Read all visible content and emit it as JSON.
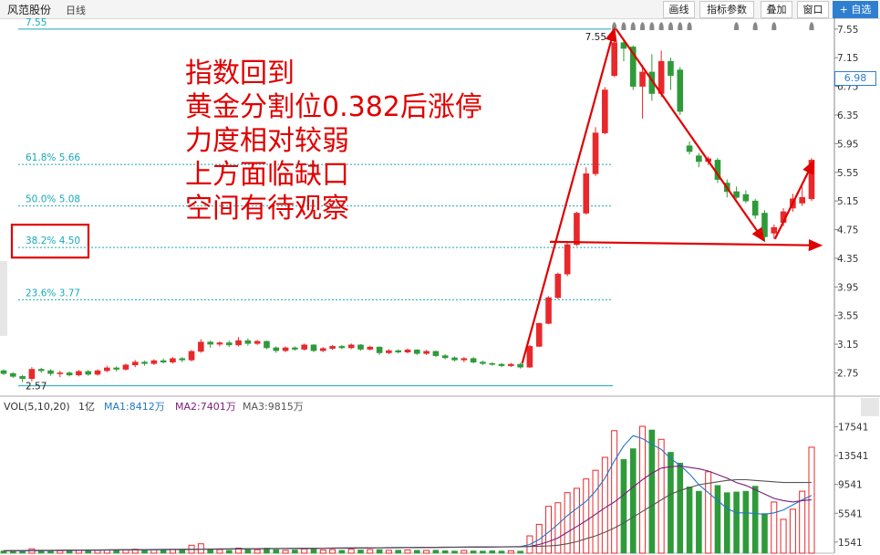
{
  "header": {
    "stock_name": "风范股份",
    "period": "日线",
    "buttons": [
      {
        "label": "画线"
      },
      {
        "label": "指标参数"
      },
      {
        "label": "叠加"
      },
      {
        "label": "窗口"
      },
      {
        "label": "+ 自选"
      }
    ]
  },
  "annotation_lines": [
    "指数回到",
    "黄金分割位0.382后涨停",
    "力度相对较弱",
    "上方面临缺口",
    "空间有待观察"
  ],
  "current_price_tag": "6.98",
  "volume_legend": {
    "indicator": "VOL(5,10,20)",
    "unit": "1亿",
    "ma1": "MA1:8412万",
    "ma2": "MA2:7401万",
    "ma3": "MA3:9815万"
  },
  "colors": {
    "up": "#e8282b",
    "down": "#2f9a3a",
    "fib": "#17a9b7",
    "ma1": "#1f77c8",
    "ma2": "#7a1c7a",
    "ma3": "#555555",
    "annot": "#e00000"
  },
  "chart_data": [
    {
      "type": "candlestick",
      "ylim": [
        2.45,
        7.65
      ],
      "y_ticks": [
        "7.55",
        "7.15",
        "6.75",
        "6.35",
        "5.95",
        "5.55",
        "5.15",
        "4.75",
        "4.35",
        "3.95",
        "3.55",
        "3.15",
        "2.75"
      ],
      "fib_levels": [
        {
          "label": "7.55",
          "value": 7.55
        },
        {
          "label": "61.8% 5.66",
          "value": 5.66
        },
        {
          "label": "50.0% 5.08",
          "value": 5.08
        },
        {
          "label": "38.2% 4.50",
          "value": 4.5
        },
        {
          "label": "23.6% 3.77",
          "value": 3.77
        },
        {
          "label": "2.57",
          "value": 2.57
        }
      ],
      "high_label": "7.55",
      "low_label": "2.57",
      "candles": [
        [
          2.78,
          2.74,
          2.8,
          2.72
        ],
        [
          2.74,
          2.7,
          2.76,
          2.68
        ],
        [
          2.7,
          2.67,
          2.72,
          2.62
        ],
        [
          2.67,
          2.8,
          2.83,
          2.63
        ],
        [
          2.8,
          2.78,
          2.82,
          2.75
        ],
        [
          2.78,
          2.74,
          2.8,
          2.71
        ],
        [
          2.74,
          2.75,
          2.78,
          2.69
        ],
        [
          2.75,
          2.72,
          2.77,
          2.7
        ],
        [
          2.72,
          2.77,
          2.79,
          2.7
        ],
        [
          2.77,
          2.73,
          2.79,
          2.71
        ],
        [
          2.73,
          2.78,
          2.8,
          2.71
        ],
        [
          2.78,
          2.82,
          2.85,
          2.76
        ],
        [
          2.82,
          2.8,
          2.84,
          2.77
        ],
        [
          2.8,
          2.86,
          2.88,
          2.78
        ],
        [
          2.86,
          2.9,
          2.93,
          2.83
        ],
        [
          2.9,
          2.88,
          2.92,
          2.85
        ],
        [
          2.88,
          2.92,
          2.94,
          2.86
        ],
        [
          2.92,
          2.9,
          2.95,
          2.88
        ],
        [
          2.9,
          2.95,
          2.97,
          2.88
        ],
        [
          2.95,
          2.93,
          2.97,
          2.9
        ],
        [
          2.93,
          3.05,
          3.07,
          2.91
        ],
        [
          3.05,
          3.18,
          3.22,
          3.03
        ],
        [
          3.18,
          3.15,
          3.2,
          3.1
        ],
        [
          3.15,
          3.17,
          3.19,
          3.12
        ],
        [
          3.17,
          3.14,
          3.2,
          3.11
        ],
        [
          3.14,
          3.2,
          3.25,
          3.12
        ],
        [
          3.2,
          3.16,
          3.23,
          3.13
        ],
        [
          3.16,
          3.19,
          3.21,
          3.14
        ],
        [
          3.19,
          3.1,
          3.2,
          3.08
        ],
        [
          3.1,
          3.06,
          3.12,
          3.03
        ],
        [
          3.06,
          3.1,
          3.12,
          3.04
        ],
        [
          3.1,
          3.08,
          3.12,
          3.06
        ],
        [
          3.08,
          3.14,
          3.16,
          3.06
        ],
        [
          3.14,
          3.06,
          3.15,
          3.04
        ],
        [
          3.06,
          3.09,
          3.11,
          3.04
        ],
        [
          3.09,
          3.12,
          3.14,
          3.07
        ],
        [
          3.12,
          3.1,
          3.14,
          3.08
        ],
        [
          3.1,
          3.14,
          3.16,
          3.08
        ],
        [
          3.14,
          3.08,
          3.15,
          3.06
        ],
        [
          3.08,
          3.11,
          3.13,
          3.06
        ],
        [
          3.11,
          3.03,
          3.12,
          3.0
        ],
        [
          3.03,
          3.06,
          3.08,
          3.01
        ],
        [
          3.06,
          3.04,
          3.08,
          3.02
        ],
        [
          3.04,
          3.07,
          3.09,
          3.02
        ],
        [
          3.07,
          3.02,
          3.08,
          3.0
        ],
        [
          3.02,
          3.05,
          3.07,
          3.0
        ],
        [
          3.05,
          2.99,
          3.06,
          2.97
        ],
        [
          2.99,
          2.96,
          3.01,
          2.94
        ],
        [
          2.96,
          2.93,
          2.98,
          2.91
        ],
        [
          2.93,
          2.95,
          2.97,
          2.9
        ],
        [
          2.95,
          2.9,
          2.97,
          2.88
        ],
        [
          2.9,
          2.88,
          2.92,
          2.86
        ],
        [
          2.88,
          2.87,
          2.9,
          2.85
        ],
        [
          2.87,
          2.85,
          2.89,
          2.83
        ],
        [
          2.85,
          2.87,
          2.89,
          2.83
        ],
        [
          2.87,
          2.83,
          2.89,
          2.81
        ],
        [
          2.83,
          3.12,
          3.14,
          2.82
        ],
        [
          3.12,
          3.44,
          3.45,
          3.11
        ],
        [
          3.44,
          3.8,
          3.82,
          3.43
        ],
        [
          3.8,
          4.13,
          4.15,
          3.78
        ],
        [
          4.13,
          4.54,
          4.58,
          4.1
        ],
        [
          4.54,
          4.98,
          5.0,
          4.52
        ],
        [
          4.98,
          5.53,
          5.62,
          4.96
        ],
        [
          5.53,
          6.1,
          6.18,
          5.5
        ],
        [
          6.1,
          6.7,
          6.74,
          6.08
        ],
        [
          6.9,
          7.36,
          7.55,
          6.88
        ],
        [
          7.36,
          7.28,
          7.4,
          7.1
        ],
        [
          7.3,
          6.75,
          7.32,
          6.7
        ],
        [
          6.75,
          6.95,
          7.05,
          6.3
        ],
        [
          6.95,
          6.65,
          7.2,
          6.55
        ],
        [
          6.65,
          7.1,
          7.25,
          6.6
        ],
        [
          7.1,
          6.9,
          7.15,
          6.7
        ],
        [
          6.98,
          6.4,
          7.02,
          6.35
        ],
        [
          5.92,
          5.84,
          5.98,
          5.8
        ],
        [
          5.78,
          5.7,
          5.82,
          5.62
        ],
        [
          5.7,
          5.74,
          5.77,
          5.65
        ],
        [
          5.72,
          5.45,
          5.75,
          5.4
        ],
        [
          5.4,
          5.28,
          5.45,
          5.2
        ],
        [
          5.28,
          5.2,
          5.35,
          5.18
        ],
        [
          5.24,
          5.15,
          5.3,
          5.12
        ],
        [
          5.15,
          4.95,
          5.18,
          4.9
        ],
        [
          4.98,
          4.65,
          5.02,
          4.58
        ],
        [
          4.7,
          4.78,
          4.82,
          4.62
        ],
        [
          4.85,
          5.0,
          5.05,
          4.8
        ],
        [
          5.05,
          5.18,
          5.25,
          5.0
        ],
        [
          5.12,
          5.2,
          5.35,
          5.08
        ],
        [
          5.18,
          5.72,
          5.75,
          5.15
        ]
      ]
    },
    {
      "type": "bar",
      "ylim": [
        0,
        19000
      ],
      "y_ticks": [
        "17541",
        "13541",
        "9541",
        "5541",
        "1541"
      ],
      "series": [
        {
          "name": "MA1:8412万",
          "values": [
            300,
            320,
            330,
            340,
            350,
            360,
            370,
            380,
            390,
            400,
            410,
            420,
            430,
            440,
            450,
            460,
            470,
            480,
            490,
            500,
            520,
            540,
            560,
            580,
            600,
            610,
            620,
            630,
            640,
            650,
            660,
            670,
            680,
            690,
            700,
            710,
            720,
            730,
            740,
            750,
            760,
            770,
            780,
            790,
            800,
            810,
            820,
            830,
            840,
            850,
            860,
            870,
            880,
            890,
            900,
            910,
            1200,
            1900,
            2900,
            4000,
            5200,
            6200,
            7200,
            8600,
            10400,
            12800,
            14900,
            16300,
            15900,
            15100,
            14400,
            13100,
            12200,
            11000,
            9500,
            8400,
            7300,
            6200,
            5600,
            5600,
            5500,
            5400,
            5600,
            6000,
            6700,
            7400,
            8000
          ]
        },
        {
          "name": "MA2:7401万",
          "values": [
            330,
            340,
            350,
            360,
            370,
            380,
            390,
            400,
            410,
            420,
            430,
            440,
            450,
            460,
            470,
            480,
            490,
            500,
            510,
            520,
            530,
            540,
            550,
            560,
            570,
            580,
            590,
            600,
            610,
            620,
            630,
            640,
            650,
            660,
            670,
            680,
            690,
            700,
            710,
            720,
            730,
            740,
            750,
            760,
            770,
            780,
            790,
            800,
            810,
            820,
            830,
            840,
            850,
            860,
            870,
            880,
            950,
            1200,
            1600,
            2100,
            2900,
            3700,
            4500,
            5400,
            6300,
            7100,
            8100,
            9200,
            10200,
            11100,
            11800,
            12000,
            12100,
            11900,
            11700,
            11400,
            10900,
            10400,
            9800,
            9400,
            8800,
            8200,
            7600,
            7300,
            7100,
            7300,
            7400
          ]
        },
        {
          "name": "MA3:9815万",
          "values": [
            360,
            370,
            380,
            390,
            400,
            410,
            420,
            430,
            440,
            450,
            460,
            470,
            480,
            490,
            500,
            510,
            520,
            530,
            540,
            550,
            560,
            570,
            580,
            590,
            600,
            610,
            620,
            630,
            640,
            650,
            660,
            670,
            680,
            690,
            700,
            710,
            720,
            730,
            740,
            750,
            760,
            770,
            780,
            790,
            800,
            810,
            820,
            830,
            840,
            850,
            860,
            870,
            880,
            890,
            900,
            910,
            930,
            960,
            1000,
            1100,
            1300,
            1600,
            2000,
            2400,
            2900,
            3500,
            4200,
            5000,
            5800,
            6600,
            7400,
            8200,
            8700,
            9100,
            9500,
            9700,
            9900,
            10100,
            10200,
            10200,
            10100,
            10000,
            9900,
            9800,
            9800,
            9800,
            9815
          ]
        }
      ],
      "values": [
        320,
        300,
        280,
        600,
        320,
        300,
        350,
        300,
        420,
        330,
        380,
        450,
        380,
        500,
        550,
        420,
        480,
        400,
        520,
        430,
        1100,
        1300,
        600,
        500,
        400,
        700,
        500,
        480,
        700,
        500,
        400,
        450,
        600,
        550,
        450,
        500,
        400,
        550,
        450,
        500,
        500,
        400,
        420,
        450,
        400,
        380,
        420,
        350,
        300,
        380,
        320,
        300,
        330,
        300,
        330,
        290,
        2400,
        4000,
        6500,
        7000,
        8400,
        9000,
        10300,
        11500,
        13300,
        17000,
        13000,
        14500,
        17600,
        17100,
        15800,
        14000,
        12500,
        9200,
        8600,
        11300,
        9400,
        8400,
        8500,
        8600,
        9300,
        5500,
        7100,
        4700,
        6100,
        8600,
        14700
      ]
    }
  ]
}
